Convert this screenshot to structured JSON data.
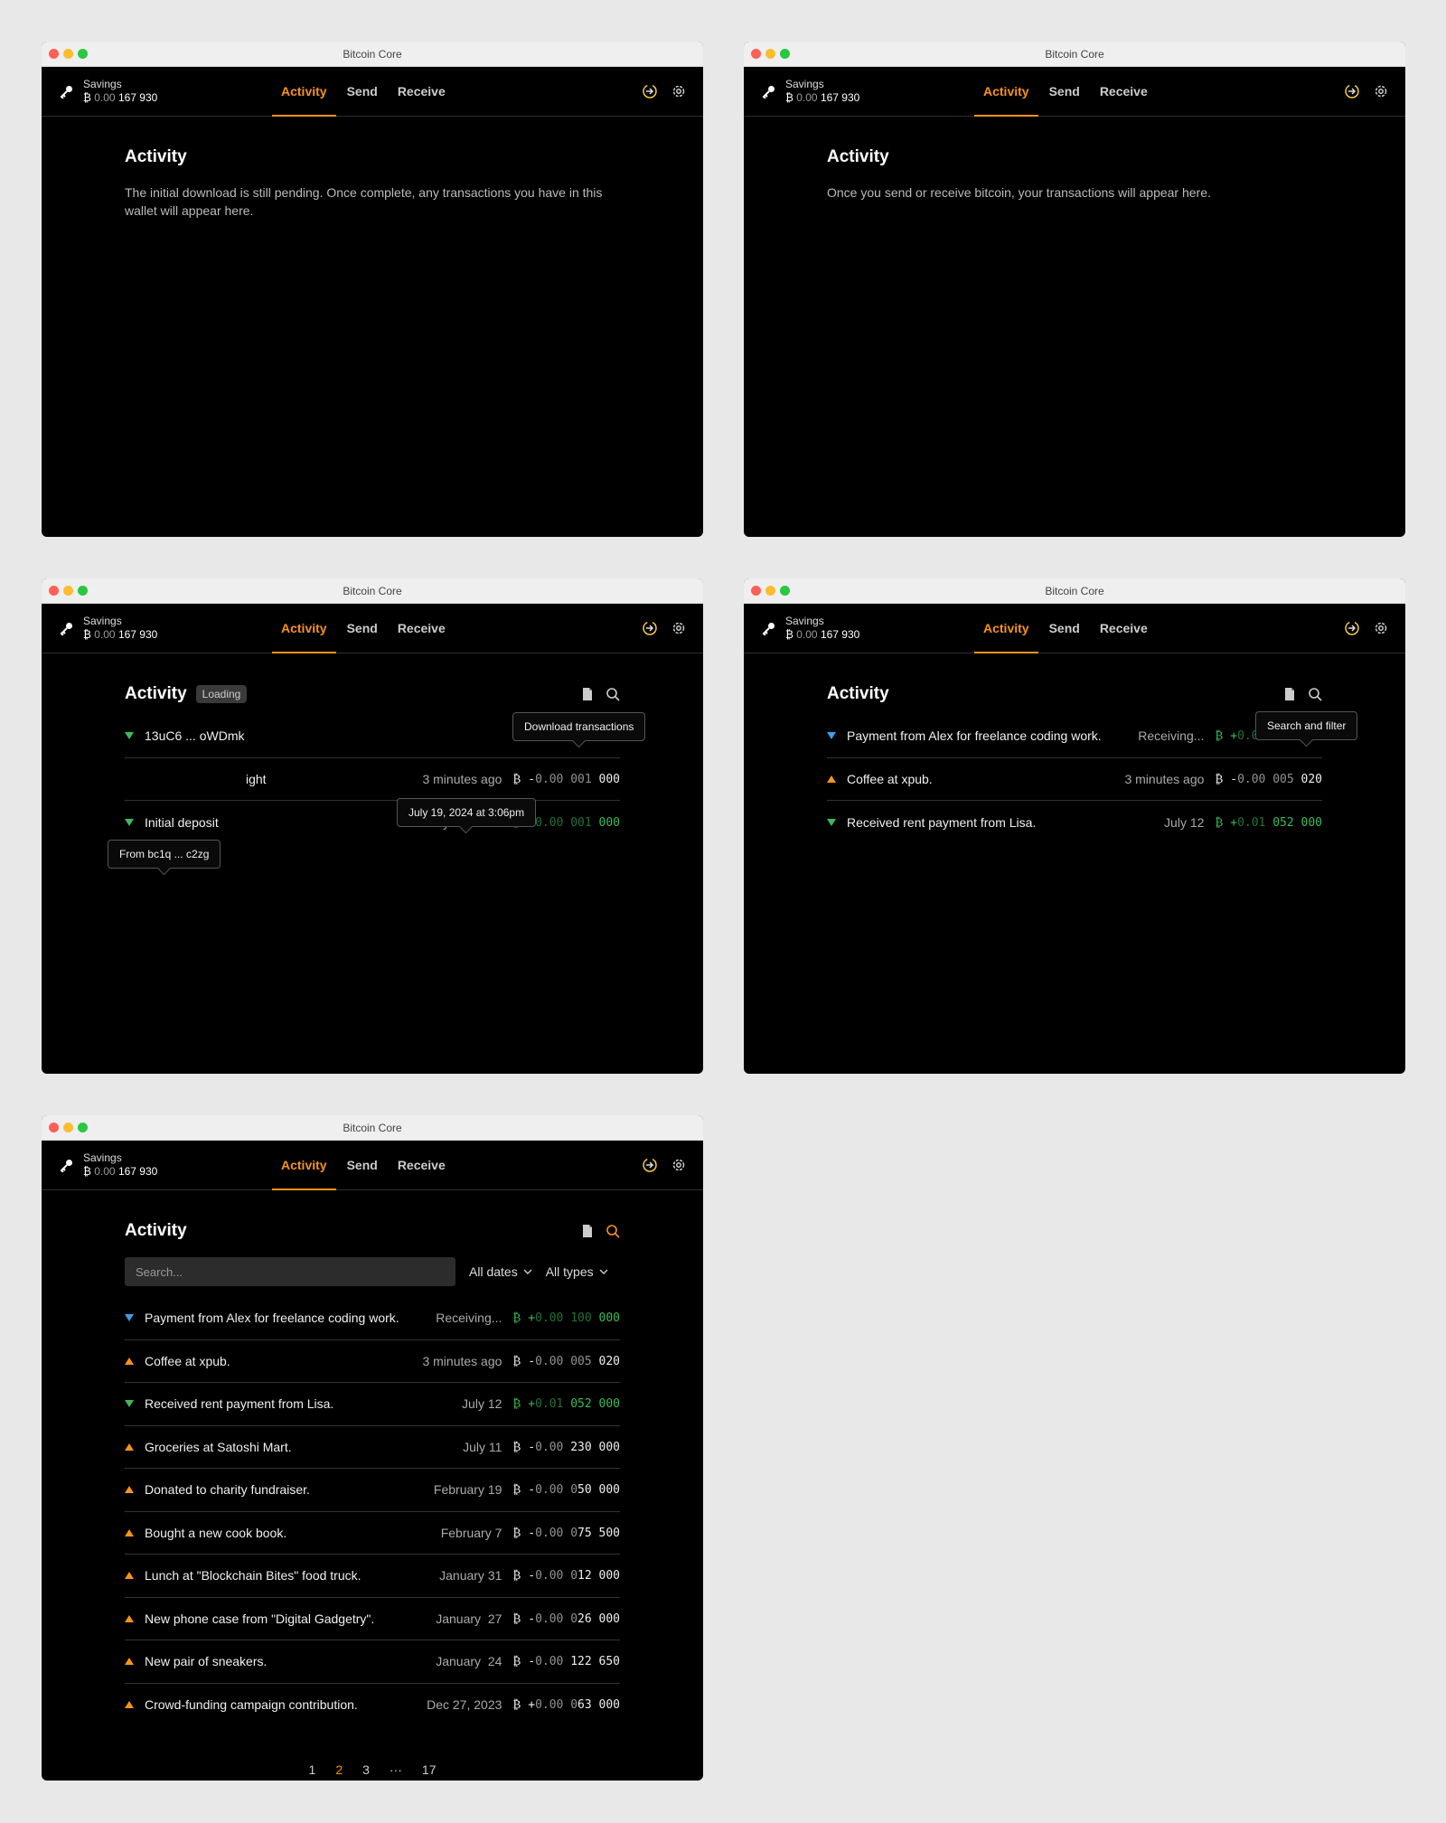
{
  "app_title": "Bitcoin Core",
  "wallet": {
    "name": "Savings",
    "balance_symbol": "₿",
    "balance_dim": "0.00",
    "balance_main": "167 930"
  },
  "nav": [
    "Activity",
    "Send",
    "Receive"
  ],
  "activity_title": "Activity",
  "win1": {
    "message": "The initial download is still pending. Once complete, any transactions you have in this wallet will appear here."
  },
  "win2": {
    "message": "Once you send or receive bitcoin, your transactions will appear here."
  },
  "win3": {
    "badge": "Loading",
    "tooltip_download": "Download transactions",
    "tooltip_date": "July 19, 2024 at 3:06pm",
    "tooltip_from": "From bc1q ... c2zg",
    "rows": [
      {
        "dir": "in",
        "label": "13uC6 ... oWDmk",
        "date": "",
        "sign": "+",
        "dim": "0.00 001",
        "main": "000"
      },
      {
        "dir": "in",
        "label": "ight",
        "date": "3 minutes ago",
        "sign": "-",
        "dim": "0.00 001",
        "main": "000"
      },
      {
        "dir": "in",
        "label": "Initial deposit",
        "date": "July 12, 2021",
        "sign": "+",
        "dim": "0.00 001",
        "main": "000"
      }
    ]
  },
  "win4": {
    "tooltip_search": "Search and filter",
    "rows": [
      {
        "dir": "pending",
        "label": "Payment from Alex for freelance coding work.",
        "date": "Receiving...",
        "sign": "+",
        "dim": "0.00 100",
        "main": "000"
      },
      {
        "dir": "out",
        "label": "Coffee at xpub.",
        "date": "3 minutes ago",
        "sign": "-",
        "dim": "0.00 005",
        "main": "020"
      },
      {
        "dir": "in",
        "label": "Received rent payment from Lisa.",
        "date": "July 12",
        "sign": "+",
        "dim": "0.01",
        "main": "052 000"
      }
    ]
  },
  "win5": {
    "search_placeholder": "Search...",
    "filter_dates": "All dates",
    "filter_types": "All types",
    "rows": [
      {
        "dir": "pending",
        "label": "Payment from Alex for freelance coding work.",
        "date": "Receiving...",
        "sign": "+",
        "dim": "0.00 100",
        "main": "000"
      },
      {
        "dir": "out",
        "label": "Coffee at xpub.",
        "date": "3 minutes ago",
        "sign": "-",
        "dim": "0.00 005",
        "main": "020"
      },
      {
        "dir": "in",
        "label": "Received rent payment from Lisa.",
        "date": "July 12",
        "sign": "+",
        "dim": "0.01",
        "main": "052 000"
      },
      {
        "dir": "out",
        "label": "Groceries at Satoshi Mart.",
        "date": "July 11",
        "sign": "-",
        "dim": "0.00",
        "main": "230 000"
      },
      {
        "dir": "out",
        "label": "Donated to charity fundraiser.",
        "date": "February 19",
        "sign": "-",
        "dim": "0.00 0",
        "main": "50 000"
      },
      {
        "dir": "out",
        "label": "Bought a new cook book.",
        "date": "February 7",
        "sign": "-",
        "dim": "0.00 0",
        "main": "75 500"
      },
      {
        "dir": "out",
        "label": "Lunch at \"Blockchain Bites\" food truck.",
        "date": "January 31",
        "sign": "-",
        "dim": "0.00 0",
        "main": "12 000"
      },
      {
        "dir": "out",
        "label": "New phone case from \"Digital Gadgetry\".",
        "date": "January  27",
        "sign": "-",
        "dim": "0.00 0",
        "main": "26 000"
      },
      {
        "dir": "out",
        "label": "New pair of sneakers.",
        "date": "January  24",
        "sign": "-",
        "dim": "0.00",
        "main": "122 650"
      },
      {
        "dir": "out",
        "label": "Crowd-funding campaign contribution.",
        "date": "Dec 27, 2023",
        "sign": "+",
        "dim": "0.00 0",
        "main": "63 000"
      }
    ],
    "pages": [
      "1",
      "2",
      "3",
      "···",
      "17"
    ],
    "current_page": "2"
  },
  "colors": {
    "accent": "#f7931a",
    "positive": "#3cba5a",
    "pending": "#3b9ee8"
  }
}
